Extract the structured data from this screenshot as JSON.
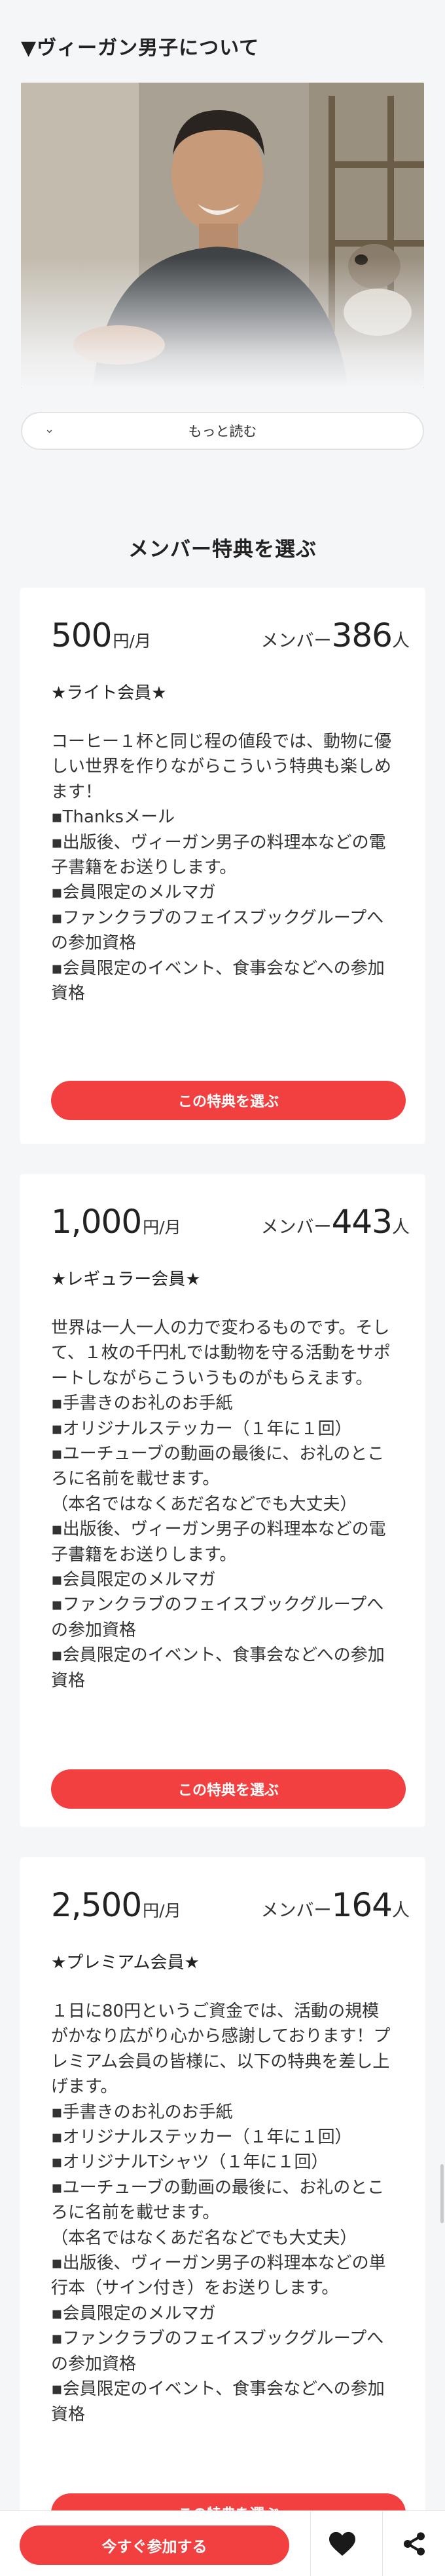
{
  "about": {
    "title": "▼ヴィーガン男子について",
    "more_label": "もっと読む"
  },
  "section_title": "メンバー特典を選ぶ",
  "plans": [
    {
      "price": "500",
      "price_unit": "円/月",
      "members_label": "メンバー",
      "members": "386",
      "members_unit": "人",
      "name": "★ライト会員★",
      "description": "コーヒー１杯と同じ程の値段では、動物に優\nしい世界を作りながらこういう特典も楽しめ\nます！\n▪Thanksメール\n▪出版後、ヴィーガン男子の料理本などの電\n子書籍をお送りします。\n▪会員限定のメルマガ\n▪ファンクラブのフェイスブックグループへ\nの参加資格\n▪会員限定のイベント、食事会などへの参加\n資格",
      "select_label": "この特典を選ぶ"
    },
    {
      "price": "1,000",
      "price_unit": "円/月",
      "members_label": "メンバー",
      "members": "443",
      "members_unit": "人",
      "name": "★レギュラー会員★",
      "description": "世界は一人一人の力で変わるものです。そし\nて、１枚の千円札では動物を守る活動をサポ\nートしながらこういうものがもらえます。\n▪手書きのお礼のお手紙\n▪オリジナルステッカー（１年に１回）\n▪ユーチューブの動画の最後に、お礼のとこ\nろに名前を載せます。\n（本名ではなくあだ名などでも大丈夫）\n▪出版後、ヴィーガン男子の料理本などの電\n子書籍をお送りします。\n▪会員限定のメルマガ\n▪ファンクラブのフェイスブックグループへ\nの参加資格\n▪会員限定のイベント、食事会などへの参加\n資格",
      "select_label": "この特典を選ぶ"
    },
    {
      "price": "2,500",
      "price_unit": "円/月",
      "members_label": "メンバー",
      "members": "164",
      "members_unit": "人",
      "name": "★プレミアム会員★",
      "description": "１日に80円というご資金では、活動の規模\nがかなり広がり心から感謝しております！プ\nレミアム会員の皆様に、以下の特典を差し上\nげます。\n▪手書きのお礼のお手紙\n▪オリジナルステッカー（１年に１回）\n▪オリジナルTシャツ（１年に１回）\n▪ユーチューブの動画の最後に、お礼のとこ\nろに名前を載せます。\n（本名ではなくあだ名などでも大丈夫）\n▪出版後、ヴィーガン男子の料理本などの単\n行本（サイン付き）をお送りします。\n▪会員限定のメルマガ\n▪ファンクラブのフェイスブックグループへ\nの参加資格\n▪会員限定のイベント、食事会などへの参加\n資格",
      "select_label": "この特典を選ぶ"
    }
  ],
  "bottom_bar": {
    "join_label": "今すぐ参加する",
    "heart_icon": "heart-icon",
    "share_icon": "share-icon"
  },
  "colors": {
    "accent": "#f23f3f",
    "background": "#f5f6f8"
  }
}
